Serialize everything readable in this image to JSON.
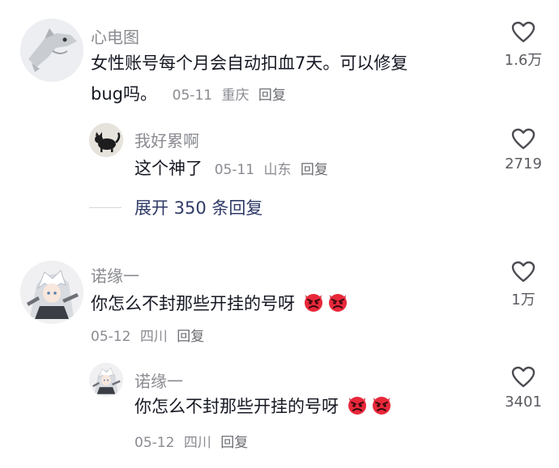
{
  "comments": [
    {
      "user": "心电图",
      "text_line1": "女性账号每个月会自动扣血7天。可以修复",
      "text_line2": "bug吗。",
      "date": "05-11",
      "location": "重庆",
      "reply_label": "回复",
      "likes": "1.6万",
      "avatar_icon": "shark-plush-avatar-icon",
      "replies": [
        {
          "user": "我好累啊",
          "text": "这个神了",
          "date": "05-11",
          "location": "山东",
          "reply_label": "回复",
          "likes": "2719",
          "avatar_icon": "black-cat-avatar-icon"
        }
      ],
      "expand_label": "展开 350 条回复"
    },
    {
      "user": "诺缘一",
      "text": "你怎么不封那些开挂的号呀",
      "emojis": [
        "angry-devil-emoji",
        "angry-devil-emoji"
      ],
      "date": "05-12",
      "location": "四川",
      "reply_label": "回复",
      "likes": "1万",
      "avatar_icon": "anime-character-avatar-icon",
      "replies": [
        {
          "user": "诺缘一",
          "text": "你怎么不封那些开挂的号呀",
          "emojis": [
            "angry-devil-emoji",
            "angry-devil-emoji"
          ],
          "date": "05-12",
          "location": "四川",
          "reply_label": "回复",
          "likes": "3401",
          "avatar_icon": "anime-character-avatar-icon"
        }
      ]
    }
  ],
  "colors": {
    "username": "#8a8b91",
    "content": "#161823",
    "expand": "#2f3a67",
    "emoji_red": "#e8283a"
  }
}
